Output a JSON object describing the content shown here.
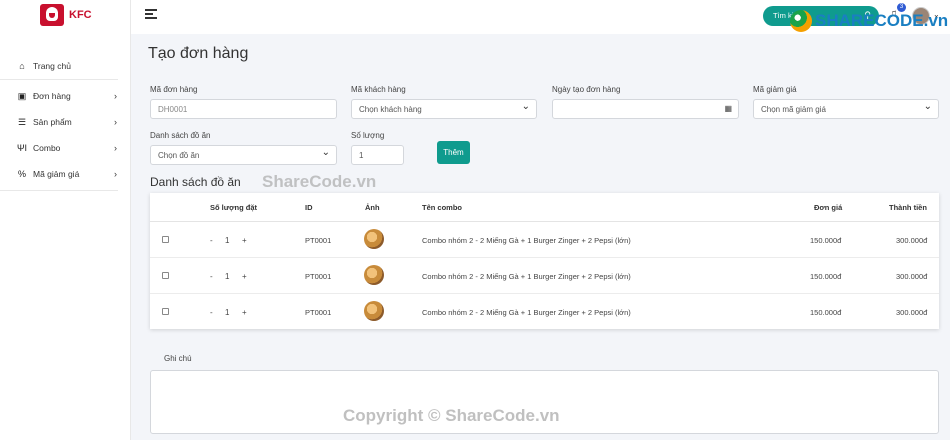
{
  "brand": {
    "name": "KFC"
  },
  "sidebar": {
    "items": [
      {
        "label": "Trang chủ",
        "icon": "home-icon",
        "has_children": false
      },
      {
        "label": "Đơn hàng",
        "icon": "money-icon",
        "has_children": true
      },
      {
        "label": "Sản phẩm",
        "icon": "burger-icon",
        "has_children": true
      },
      {
        "label": "Combo",
        "icon": "utensils-icon",
        "has_children": true
      },
      {
        "label": "Mã giảm giá",
        "icon": "percent-icon",
        "has_children": true
      }
    ]
  },
  "topbar": {
    "search_placeholder": "Tìm kiếm",
    "notification_count": "3"
  },
  "page": {
    "title": "Tạo đơn hàng"
  },
  "form": {
    "order_id_label": "Mã đơn hàng",
    "order_id_placeholder": "DH0001",
    "customer_label": "Mã khách hàng",
    "customer_value": "Chọn khách hàng",
    "date_label": "Ngày tạo đơn hàng",
    "date_value": "",
    "discount_label": "Mã giảm giá",
    "discount_value": "Chọn mã giảm giá",
    "food_list_label": "Danh sách đồ ăn",
    "food_value": "Chọn đồ ăn",
    "qty_label": "Số lượng",
    "qty_value": "1",
    "add_button": "Thêm"
  },
  "food_table": {
    "title": "Danh sách đồ ăn",
    "columns": [
      "Số lượng đặt",
      "ID",
      "Ảnh",
      "Tên combo",
      "Đơn giá",
      "Thành tiền"
    ],
    "rows": [
      {
        "qty": "1",
        "id": "PT0001",
        "name": "Combo nhóm 2 - 2 Miếng Gà + 1 Burger Zinger + 2 Pepsi (lớn)",
        "unit_price": "150.000đ",
        "total": "300.000đ"
      },
      {
        "qty": "1",
        "id": "PT0001",
        "name": "Combo nhóm 2 - 2 Miếng Gà + 1 Burger Zinger + 2 Pepsi (lớn)",
        "unit_price": "150.000đ",
        "total": "300.000đ"
      },
      {
        "qty": "1",
        "id": "PT0001",
        "name": "Combo nhóm 2 - 2 Miếng Gà + 1 Burger Zinger + 2 Pepsi (lớn)",
        "unit_price": "150.000đ",
        "total": "300.000đ"
      }
    ]
  },
  "notes": {
    "label": "Ghi chú",
    "value": ""
  },
  "watermarks": {
    "logo": "SHARECODE.vn",
    "middle": "ShareCode.vn",
    "bottom": "Copyright © ShareCode.vn"
  },
  "colors": {
    "accent": "#0f9b8e",
    "brand": "#c8102e",
    "badge": "#2f5bd3"
  }
}
